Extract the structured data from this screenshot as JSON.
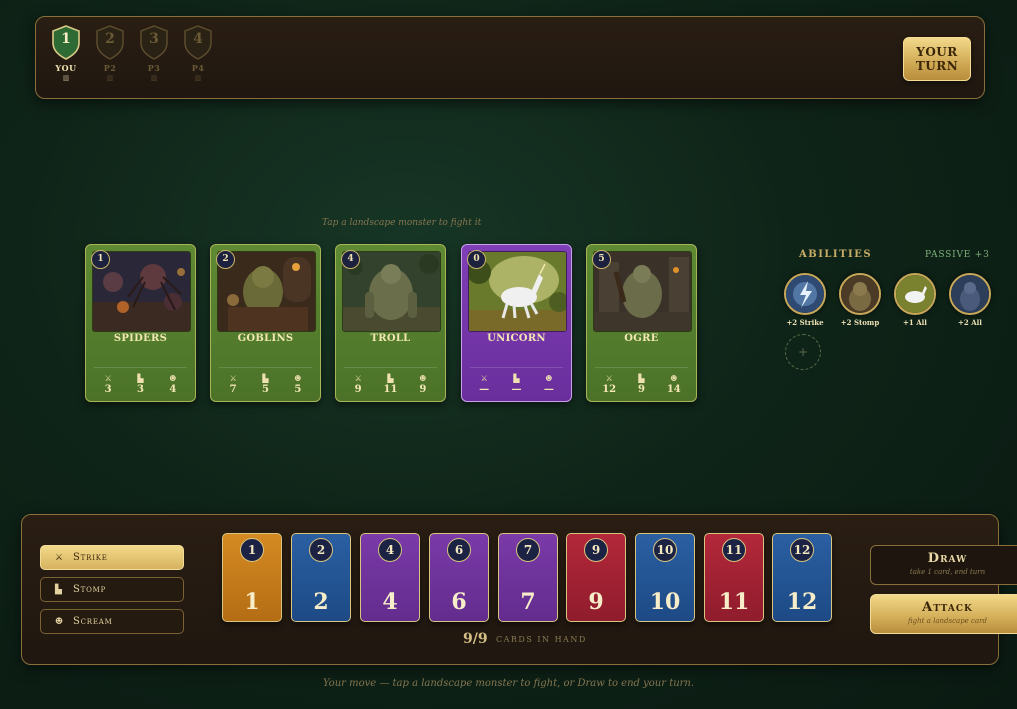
{
  "players": [
    {
      "number": "1",
      "name": "YOU",
      "status": "active"
    },
    {
      "number": "2",
      "name": "P2",
      "status": "inactive"
    },
    {
      "number": "3",
      "name": "P3",
      "status": "inactive"
    },
    {
      "number": "4",
      "name": "P4",
      "status": "inactive"
    }
  ],
  "turn_button": "YOUR TURN",
  "hint": "Tap a landscape monster to fight it",
  "monsters": [
    {
      "level": "1",
      "name": "SPIDERS",
      "strike": "3",
      "stomp": "3",
      "scream": "4",
      "color": "green"
    },
    {
      "level": "2",
      "name": "GOBLINS",
      "strike": "7",
      "stomp": "5",
      "scream": "5",
      "color": "green"
    },
    {
      "level": "4",
      "name": "TROLL",
      "strike": "9",
      "stomp": "11",
      "scream": "9",
      "color": "green"
    },
    {
      "level": "0",
      "name": "UNICORN",
      "strike": "—",
      "stomp": "—",
      "scream": "—",
      "color": "purple"
    },
    {
      "level": "5",
      "name": "OGRE",
      "strike": "12",
      "stomp": "9",
      "scream": "14",
      "color": "green"
    }
  ],
  "abilities": {
    "title": "ABILITIES",
    "passive": "PASSIVE +3",
    "items": [
      {
        "label": "+2 Strike",
        "icon": "lightning-orb-icon"
      },
      {
        "label": "+2 Stomp",
        "icon": "goblin-orb-icon"
      },
      {
        "label": "+1 All",
        "icon": "unicorn-orb-icon"
      },
      {
        "label": "+2 All",
        "icon": "troll-orb-icon"
      }
    ],
    "add": "+"
  },
  "actions": [
    {
      "label": "Strike",
      "selected": true,
      "icon": "sword-icon"
    },
    {
      "label": "Stomp",
      "selected": false,
      "icon": "boot-icon"
    },
    {
      "label": "Scream",
      "selected": false,
      "icon": "mask-icon"
    }
  ],
  "hand": [
    {
      "value": "1",
      "color": "orange"
    },
    {
      "value": "2",
      "color": "blue"
    },
    {
      "value": "4",
      "color": "purple"
    },
    {
      "value": "6",
      "color": "purple"
    },
    {
      "value": "7",
      "color": "purple"
    },
    {
      "value": "9",
      "color": "red"
    },
    {
      "value": "10",
      "color": "blue"
    },
    {
      "value": "11",
      "color": "red"
    },
    {
      "value": "12",
      "color": "blue"
    }
  ],
  "hand_count": "9/9",
  "hand_label": "CARDS IN HAND",
  "draw": {
    "title": "Draw",
    "sub": "take 1 card, end turn"
  },
  "attack": {
    "title": "Attack",
    "sub": "fight a landscape card"
  },
  "footer": "Your move — tap a landscape monster to fight, or Draw to end your turn."
}
